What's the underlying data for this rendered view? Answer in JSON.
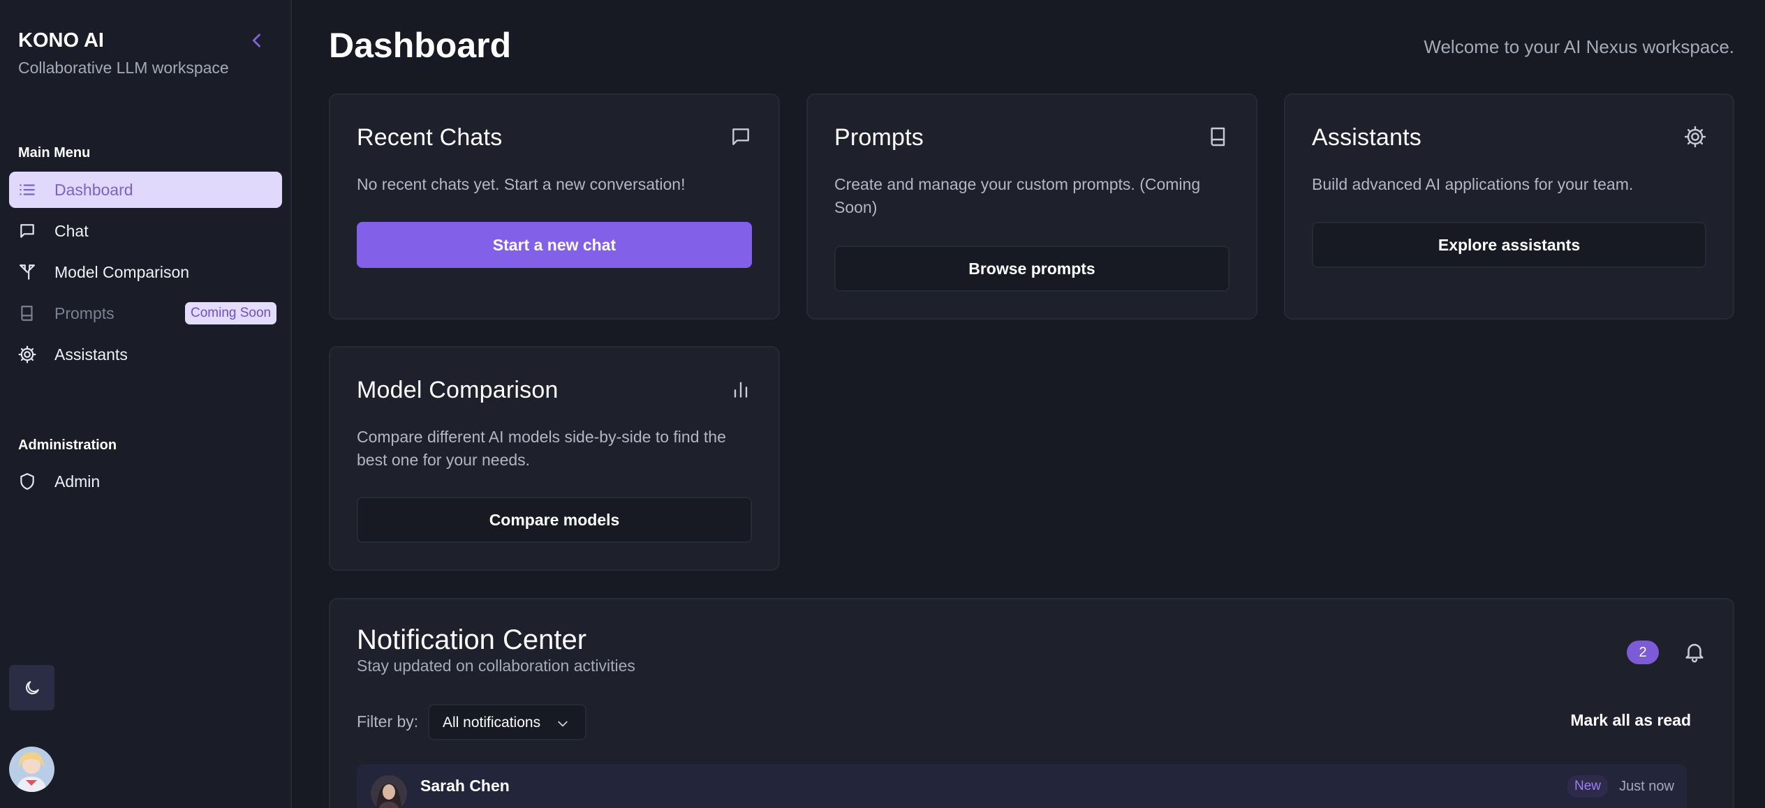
{
  "sidebar": {
    "brand_title": "KONO AI",
    "brand_subtitle": "Collaborative LLM workspace",
    "main_menu_label": "Main Menu",
    "admin_label": "Administration",
    "items": [
      {
        "label": "Dashboard",
        "icon": "list-icon",
        "active": true
      },
      {
        "label": "Chat",
        "icon": "chat-bubble-icon"
      },
      {
        "label": "Model Comparison",
        "icon": "split-arrows-icon"
      },
      {
        "label": "Prompts",
        "icon": "book-icon",
        "badge": "Coming Soon",
        "disabled": true
      },
      {
        "label": "Assistants",
        "icon": "gear-icon"
      }
    ],
    "admin_items": [
      {
        "label": "Admin",
        "icon": "shield-icon"
      }
    ],
    "theme_toggle_icon": "moon-icon"
  },
  "header": {
    "title": "Dashboard",
    "welcome": "Welcome to your AI Nexus workspace."
  },
  "cards": [
    {
      "title": "Recent Chats",
      "icon": "chat-bubble-icon",
      "description": "No recent chats yet. Start a new conversation!",
      "button": "Start a new chat"
    },
    {
      "title": "Prompts",
      "icon": "book-icon",
      "description": "Create and manage your custom prompts. (Coming Soon)",
      "button": "Browse prompts"
    },
    {
      "title": "Assistants",
      "icon": "gear-icon",
      "description": "Build advanced AI applications for your team.",
      "button": "Explore assistants"
    },
    {
      "title": "Model Comparison",
      "icon": "bar-chart-icon",
      "description": "Compare different AI models side-by-side to find the best one for your needs.",
      "button": "Compare models"
    }
  ],
  "notifications": {
    "title": "Notification Center",
    "subtitle": "Stay updated on collaboration activities",
    "count": "2",
    "filter_label": "Filter by:",
    "filter_value": "All notifications",
    "mark_all": "Mark all as read",
    "items": [
      {
        "name": "Sarah Chen",
        "badge": "New",
        "time": "Just now"
      }
    ]
  },
  "colors": {
    "accent": "#8360e8",
    "background": "#171923",
    "card": "#1e202c",
    "active_nav": "#e0d9fb"
  }
}
